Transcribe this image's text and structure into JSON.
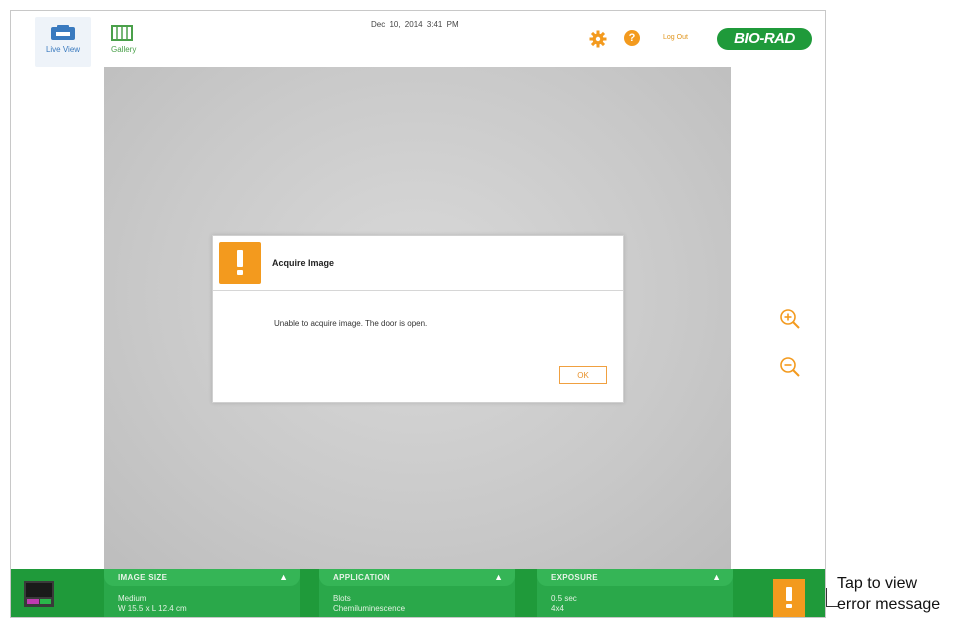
{
  "header": {
    "nav": [
      {
        "label": "Live View",
        "icon": "camera-icon"
      },
      {
        "label": "Gallery",
        "icon": "gallery-icon"
      }
    ],
    "datetime": "Dec 10, 2014   3:41 PM",
    "settings_icon": "gear-icon",
    "help_icon_glyph": "?",
    "logout_label": "Log Out",
    "logo_text": "BIO-RAD"
  },
  "dialog": {
    "title": "Acquire Image",
    "message": "Unable to acquire image. The door is open.",
    "ok_label": "OK",
    "icon": "warning-icon"
  },
  "bottom_bar": {
    "panels": [
      {
        "title": "IMAGE SIZE",
        "line1": "Medium",
        "line2": "W 15.5 x L 12.4 cm"
      },
      {
        "title": "APPLICATION",
        "line1": "Blots",
        "line2": "Chemiluminescence"
      },
      {
        "title": "EXPOSURE",
        "line1": "0.5 sec",
        "line2": "4x4"
      }
    ]
  },
  "callout": {
    "line1": "Tap to view",
    "line2": "error message"
  },
  "colors": {
    "accent_orange": "#f39a1e",
    "brand_green": "#1f9a3a",
    "live_view_blue": "#3a7abf"
  }
}
